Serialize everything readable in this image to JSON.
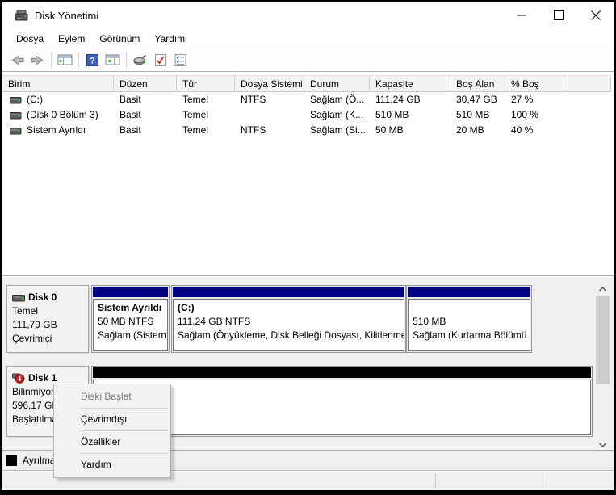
{
  "window": {
    "title": "Disk Yönetimi"
  },
  "menubar": {
    "items": [
      "Dosya",
      "Eylem",
      "Görünüm",
      "Yardım"
    ]
  },
  "toolbar": {
    "icons": [
      "back-arrow",
      "forward-arrow",
      "console-tree",
      "help",
      "action-pane",
      "rescan-disks",
      "validate",
      "checklist"
    ]
  },
  "volume_table": {
    "columns": [
      "Birim",
      "Düzen",
      "Tür",
      "Dosya Sistemi",
      "Durum",
      "Kapasite",
      "Boş Alan",
      "% Boş",
      ""
    ],
    "rows": [
      [
        "(C:)",
        "Basit",
        "Temel",
        "NTFS",
        "Sağlam (Ö...",
        "111,24 GB",
        "30,47 GB",
        "27 %"
      ],
      [
        "(Disk 0 Bölüm 3)",
        "Basit",
        "Temel",
        "",
        "Sağlam (K...",
        "510 MB",
        "510 MB",
        "100 %"
      ],
      [
        "Sistem Ayrıldı",
        "Basit",
        "Temel",
        "NTFS",
        "Sağlam (Si...",
        "50 MB",
        "20 MB",
        "40 %"
      ]
    ]
  },
  "graphical_view": {
    "disk0": {
      "name": "Disk 0",
      "type": "Temel",
      "size": "111,79 GB",
      "status": "Çevrimiçi",
      "partitions": [
        {
          "title": "Sistem Ayrıldı",
          "line2": "50 MB NTFS",
          "line3": "Sağlam (Sistem,"
        },
        {
          "title": "(C:)",
          "line2": "111,24 GB NTFS",
          "line3": "Sağlam (Önyükleme, Disk Belleği Dosyası, Kilitlenme"
        },
        {
          "title": "",
          "line2": "510 MB",
          "line3": "Sağlam (Kurtarma Bölümü"
        }
      ]
    },
    "disk1": {
      "name": "Disk 1",
      "type": "Bilinmiyor",
      "size": "596,17 GB",
      "status": "Başlatılmadı"
    }
  },
  "legend": {
    "unallocated_label": "Ayrılmamış"
  },
  "context_menu": {
    "items": [
      {
        "label": "Diski Başlat",
        "enabled": false
      },
      {
        "label": "Çevrimdışı",
        "enabled": true
      },
      {
        "label": "Özellikler",
        "enabled": true
      },
      {
        "label": "Yardım",
        "enabled": true
      }
    ]
  },
  "colors": {
    "primary_partition": "#000082",
    "unallocated": "#000000",
    "pane_bg": "#f0f0f0",
    "help_icon_blue": "#3c5fc0",
    "error_badge_red": "#c11f1f"
  }
}
